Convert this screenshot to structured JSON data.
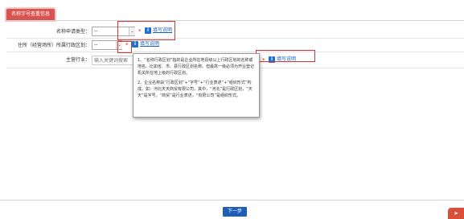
{
  "tab": {
    "label": "名称字号查重信息"
  },
  "form": {
    "rows": [
      {
        "label": "名称申请类型：",
        "select_value": "--",
        "help_label": "填写说明"
      },
      {
        "label": "住所（经营场所）所属行政区划：",
        "select_value": "--",
        "help_label": "填写说明"
      },
      {
        "label": "主营行业：",
        "input_placeholder": "输入关键词搜索",
        "help_label": "填写说明"
      }
    ],
    "required_mark": "*"
  },
  "tooltip": {
    "p1": "1、“名称行政区划”指的是企业所在地县级以上行政区划的名称或地名。比如省、市、县行政区划名称。但最高一级必须为开业登记机关所在地上级的行政区划。",
    "p2": "2、企业名称由“行政区划”+“字号”+“行业表述”+“组织形式”构成。如：河北天天商贸有限公司，其中，“河北”是行政区划，“天天”是字号，“商贸”是行业表述，“有限公司”是组织形式。"
  },
  "buttons": {
    "next": "下一步"
  },
  "colors": {
    "accent": "#d9534f",
    "link": "#1a5fb4",
    "primary_button": "#1f5fb8",
    "highlight_box": "#e03030"
  }
}
